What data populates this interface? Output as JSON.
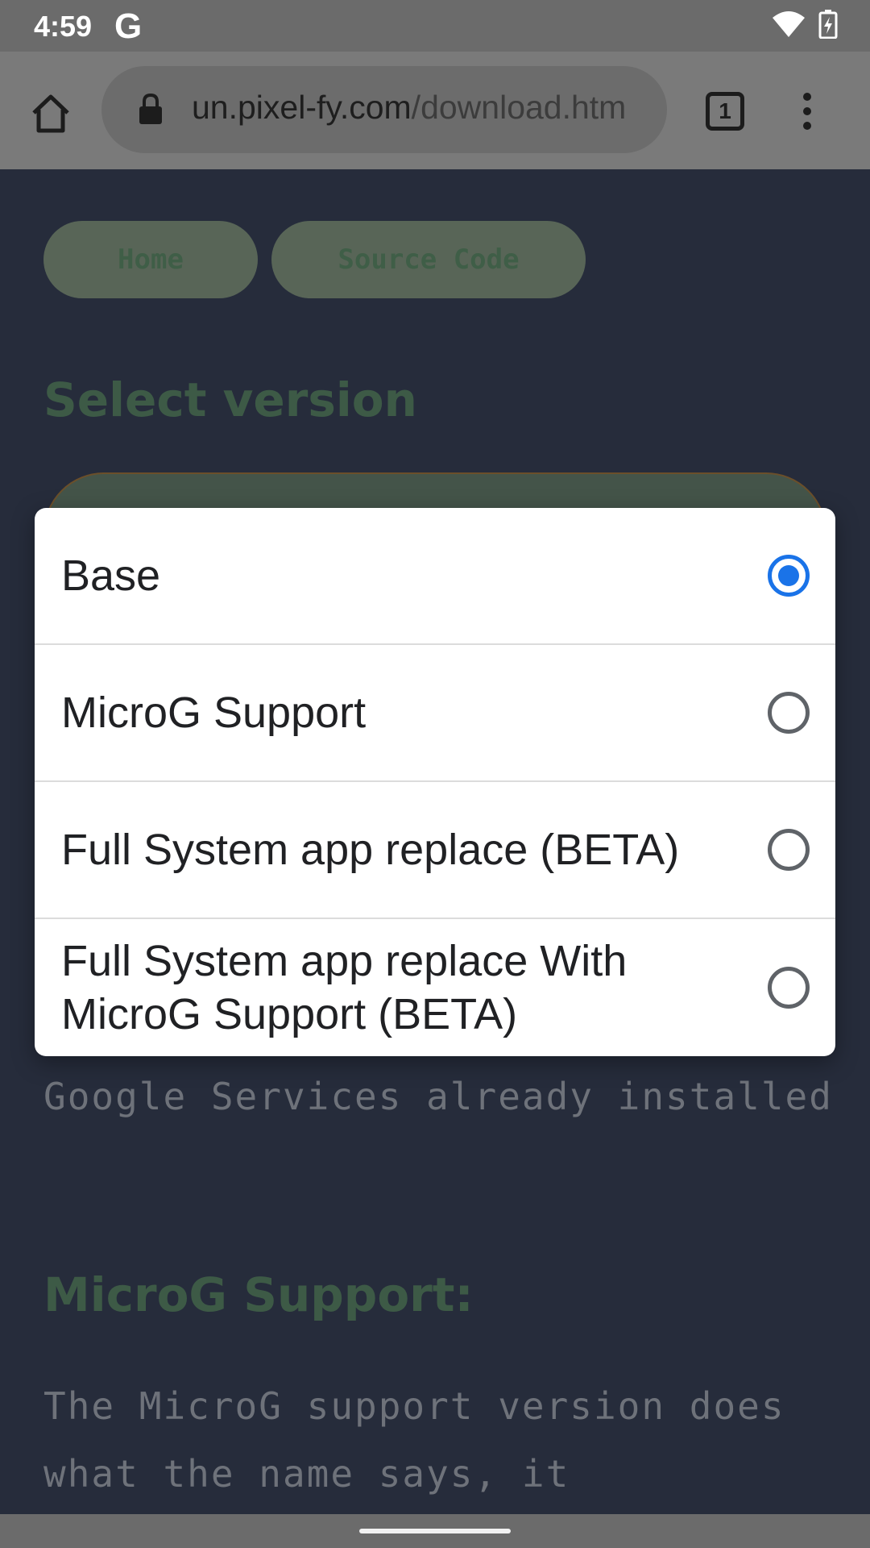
{
  "status_bar": {
    "time": "4:59",
    "g_glyph": "G",
    "icons": [
      "google-icon",
      "wifi-icon",
      "battery-charging-icon"
    ]
  },
  "browser": {
    "url_host": "un.pixel-fy.com",
    "url_path": "/download.htm",
    "tab_count": "1",
    "icons": [
      "home-icon",
      "lock-icon",
      "tabs-icon",
      "overflow-menu-icon"
    ]
  },
  "page": {
    "nav": {
      "home_label": "Home",
      "source_label": "Source Code"
    },
    "select_heading": "Select version",
    "paragraph1": "Google Services already installed",
    "microg_heading": "MicroG Support:",
    "paragraph2": "The MicroG support version does what the name says, it"
  },
  "dialog": {
    "options": [
      {
        "label": "Base",
        "selected": true
      },
      {
        "label": "MicroG Support",
        "selected": false
      },
      {
        "label": "Full System app replace (BETA)",
        "selected": false
      },
      {
        "label": "Full System app replace With MicroG Support (BETA)",
        "selected": false
      }
    ],
    "accent_color": "#1a73e8"
  }
}
